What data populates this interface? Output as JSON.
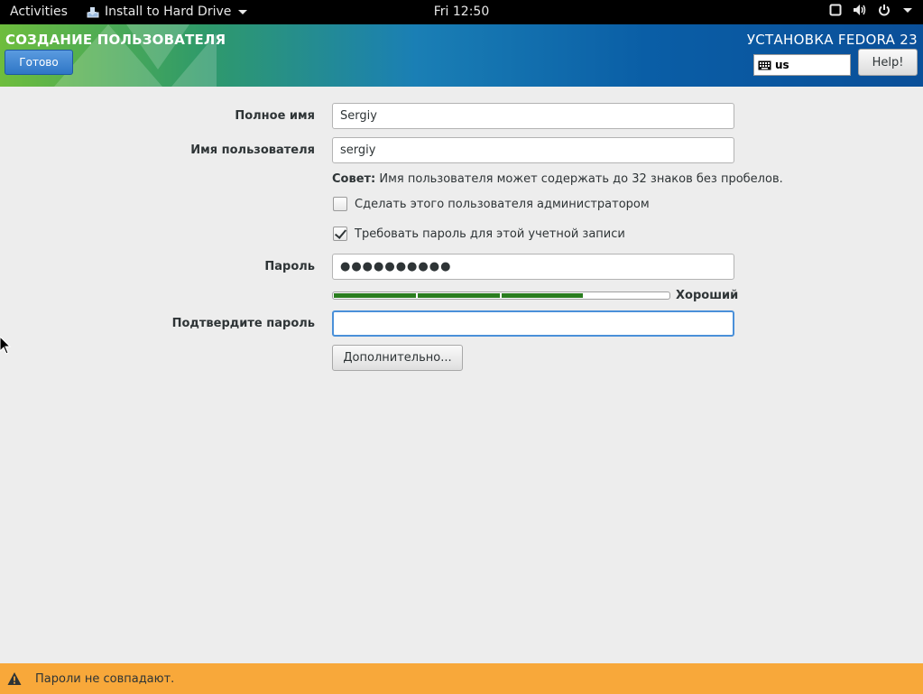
{
  "topbar": {
    "activities": "Activities",
    "app_name": "Install to Hard Drive",
    "clock": "Fri 12:50"
  },
  "header": {
    "title": "СОЗДАНИЕ ПОЛЬЗОВАТЕЛЯ",
    "done_label": "Готово",
    "product": "УСТАНОВКА FEDORA 23",
    "keyboard_layout": "us",
    "help_label": "Help!"
  },
  "form": {
    "fullname_label": "Полное имя",
    "fullname_value": "Sergiy",
    "username_label": "Имя пользователя",
    "username_value": "sergiy",
    "hint_bold": "Совет:",
    "hint_text": " Имя пользователя может содержать до 32 знаков без пробелов.",
    "admin_label": "Сделать этого пользователя администратором",
    "admin_checked": false,
    "require_pw_label": "Требовать пароль для этой учетной записи",
    "require_pw_checked": true,
    "password_label": "Пароль",
    "password_value": "●●●●●●●●●●",
    "strength_label": "Хороший",
    "strength_fraction": 0.75,
    "confirm_label": "Подтвердите пароль",
    "confirm_value": "",
    "advanced_label": "Дополнительно..."
  },
  "status": {
    "warning": "Пароли не совпадают."
  },
  "colors": {
    "accent": "#2f76c6",
    "strength": "#2a7d1f",
    "warning_bg": "#f8a83a"
  }
}
